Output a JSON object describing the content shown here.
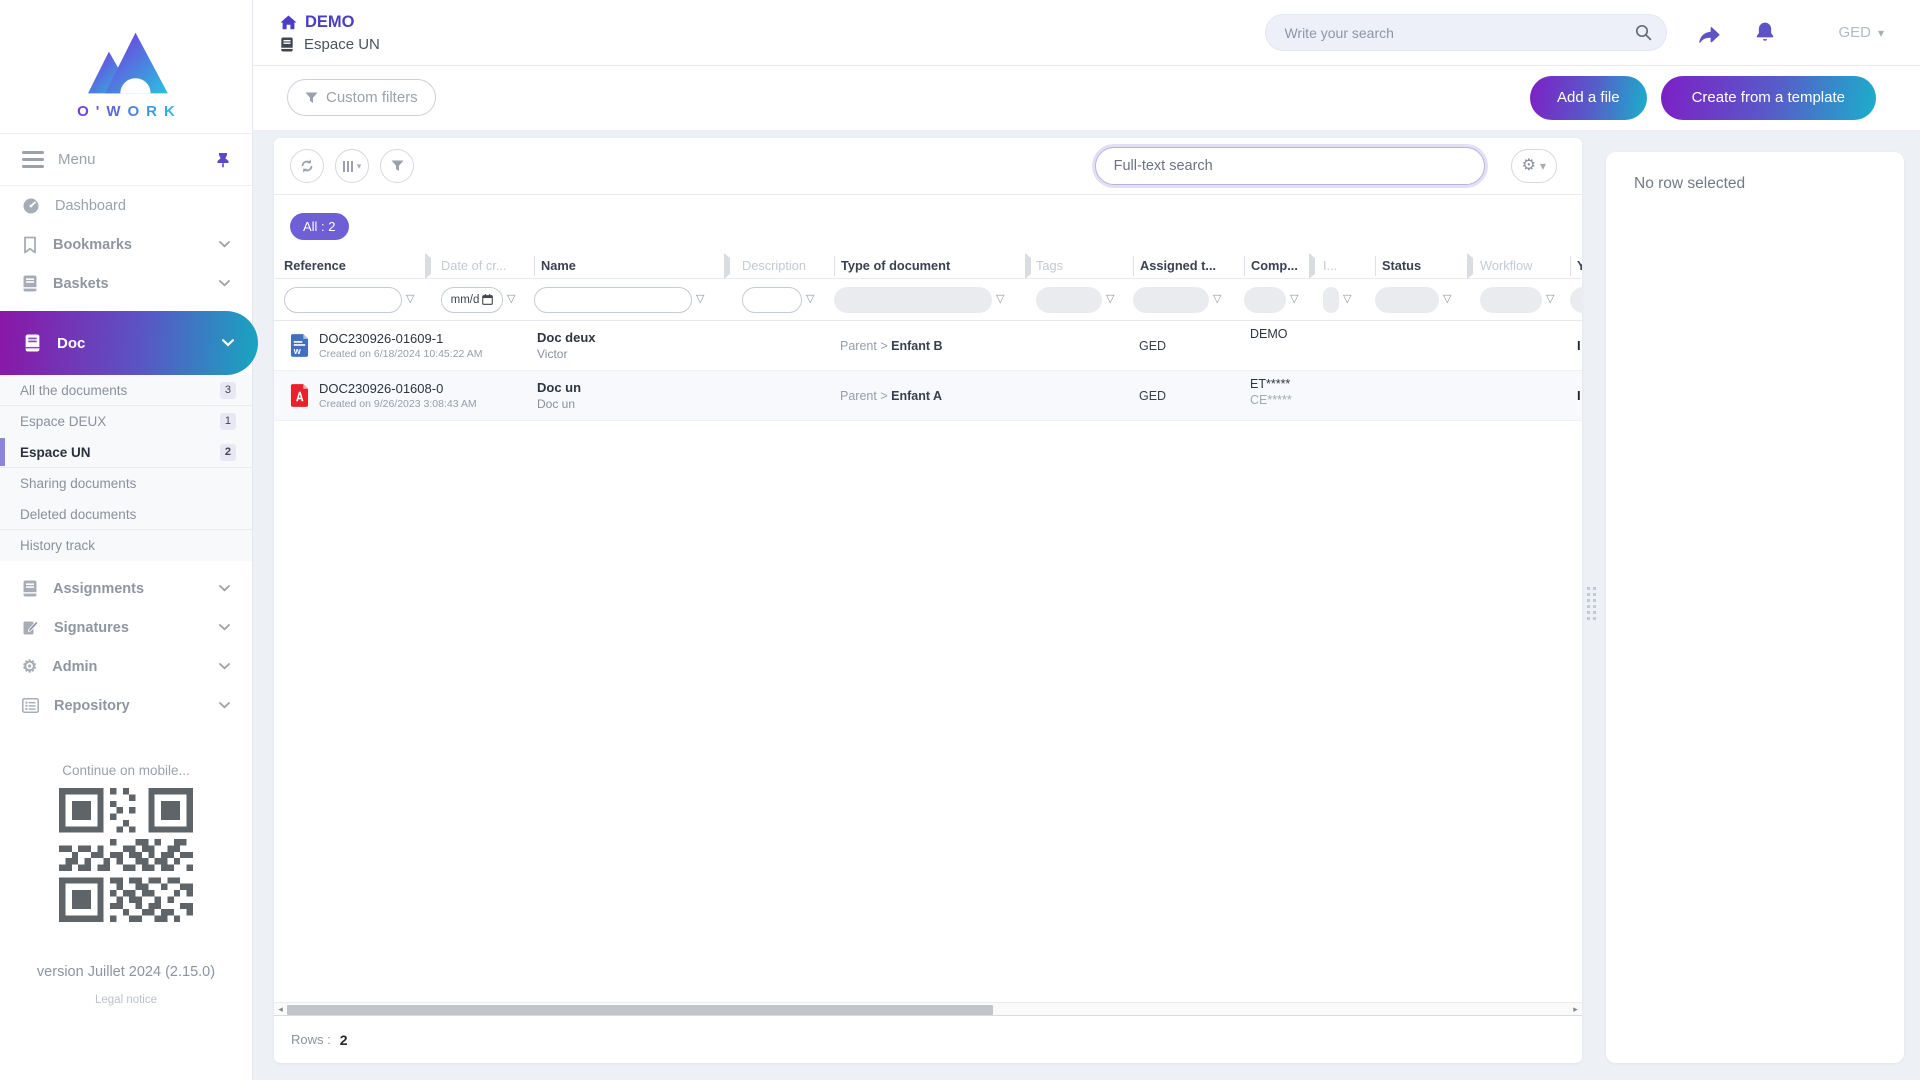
{
  "brand": {
    "logo_text": "O'WORK"
  },
  "header": {
    "app_title": "DEMO",
    "space_title": "Espace UN",
    "search_placeholder": "Write your search",
    "user_menu": "GED",
    "custom_filters": "Custom filters",
    "add_file": "Add a file",
    "create_from_template": "Create from a template"
  },
  "sidebar": {
    "menu_label": "Menu",
    "nav": [
      {
        "label": "Dashboard"
      },
      {
        "label": "Bookmarks"
      },
      {
        "label": "Baskets"
      }
    ],
    "doc_section": {
      "label": "Doc"
    },
    "doc_children": [
      {
        "label": "All the documents",
        "badge": "3"
      },
      {
        "label": "Espace DEUX",
        "badge": "1"
      },
      {
        "label": "Espace UN",
        "badge": "2"
      },
      {
        "label": "Sharing documents",
        "badge": ""
      },
      {
        "label": "Deleted documents",
        "badge": ""
      },
      {
        "label": "History track",
        "badge": ""
      }
    ],
    "nav_bottom": [
      {
        "label": "Assignments"
      },
      {
        "label": "Signatures"
      },
      {
        "label": "Admin"
      },
      {
        "label": "Repository"
      }
    ],
    "mobile_hint": "Continue on mobile...",
    "version": "version Juillet 2024 (2.15.0)",
    "legal_notice": "Legal notice"
  },
  "main": {
    "fulltext_placeholder": "Full-text search",
    "result_badge": "All : 2",
    "table": {
      "columns": [
        {
          "label": "Reference"
        },
        {
          "label": "Date of cr..."
        },
        {
          "label": "Name"
        },
        {
          "label": "Description"
        },
        {
          "label": "Type of document"
        },
        {
          "label": "Tags"
        },
        {
          "label": "Assigned t..."
        },
        {
          "label": "Comp..."
        },
        {
          "label": "I..."
        },
        {
          "label": "Status"
        },
        {
          "label": "Workflow"
        },
        {
          "label": "Y"
        }
      ],
      "date_placeholder": "mm/d",
      "rows": [
        {
          "file_type": "word",
          "reference": "DOC230926-01609-1",
          "created": "Created on 6/18/2024 10:45:22 AM",
          "name": "Doc deux",
          "subtitle": "Victor",
          "type_parent": "Parent",
          "type_sep": ">",
          "type_child": "Enfant B",
          "assigned_to": "GED",
          "company": "DEMO",
          "company_sub": "",
          "clipped": "I"
        },
        {
          "file_type": "pdf",
          "reference": "DOC230926-01608-0",
          "created": "Created on 9/26/2023 3:08:43 AM",
          "name": "Doc un",
          "subtitle": "Doc un",
          "type_parent": "Parent",
          "type_sep": ">",
          "type_child": "Enfant A",
          "assigned_to": "GED",
          "company": "ET*****",
          "company_sub": "CE*****",
          "clipped": "I"
        }
      ]
    },
    "footer": {
      "rows_label": "Rows :",
      "rows_count": "2"
    }
  },
  "right_panel": {
    "empty_message": "No row selected"
  },
  "icons": {
    "gear": "⚙",
    "caret": "▾",
    "funnel_small": "▽",
    "scroll_left": "◂",
    "scroll_right": "▸"
  },
  "colors": {
    "accent_purple": "#5e53c5",
    "gradient_start": "#8a16a8",
    "gradient_end": "#17a6c0",
    "badge_purple": "#6f5fd6",
    "pdf_red": "#e8212a",
    "word_blue": "#4170c0"
  }
}
